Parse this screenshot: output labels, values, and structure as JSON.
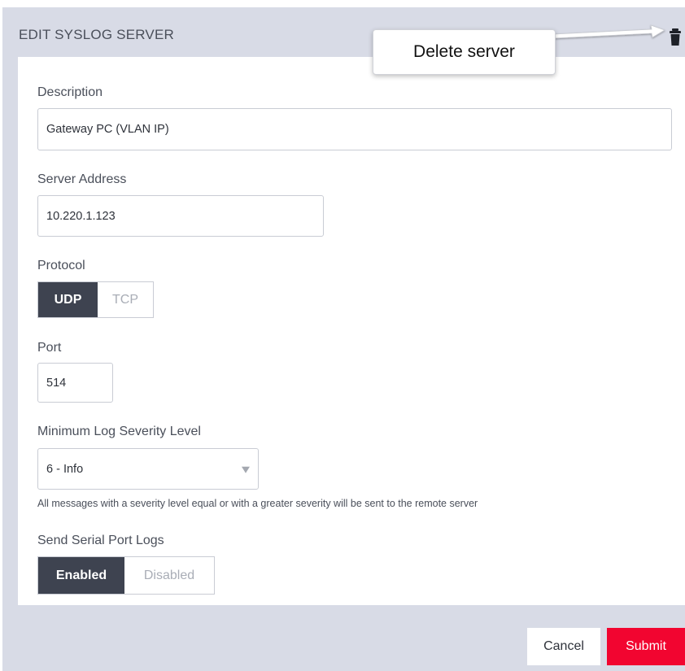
{
  "dialog": {
    "title": "EDIT SYSLOG SERVER",
    "delete_icon": "trash-icon"
  },
  "annotation": {
    "text": "Delete server"
  },
  "form": {
    "description": {
      "label": "Description",
      "value": "Gateway PC (VLAN IP)"
    },
    "server_address": {
      "label": "Server Address",
      "value": "10.220.1.123"
    },
    "protocol": {
      "label": "Protocol",
      "options": [
        "UDP",
        "TCP"
      ],
      "selected": "UDP"
    },
    "port": {
      "label": "Port",
      "value": "514"
    },
    "severity": {
      "label": "Minimum Log Severity Level",
      "value": "6 - Info",
      "help": "All messages with a severity level equal or with a greater severity will be sent to the remote server"
    },
    "serial_logs": {
      "label": "Send Serial Port Logs",
      "options": [
        "Enabled",
        "Disabled"
      ],
      "selected": "Enabled"
    }
  },
  "footer": {
    "cancel_label": "Cancel",
    "submit_label": "Submit"
  },
  "colors": {
    "dialog_bg": "#d8dbe6",
    "active_segment": "#3e4350",
    "submit": "#f20530"
  }
}
